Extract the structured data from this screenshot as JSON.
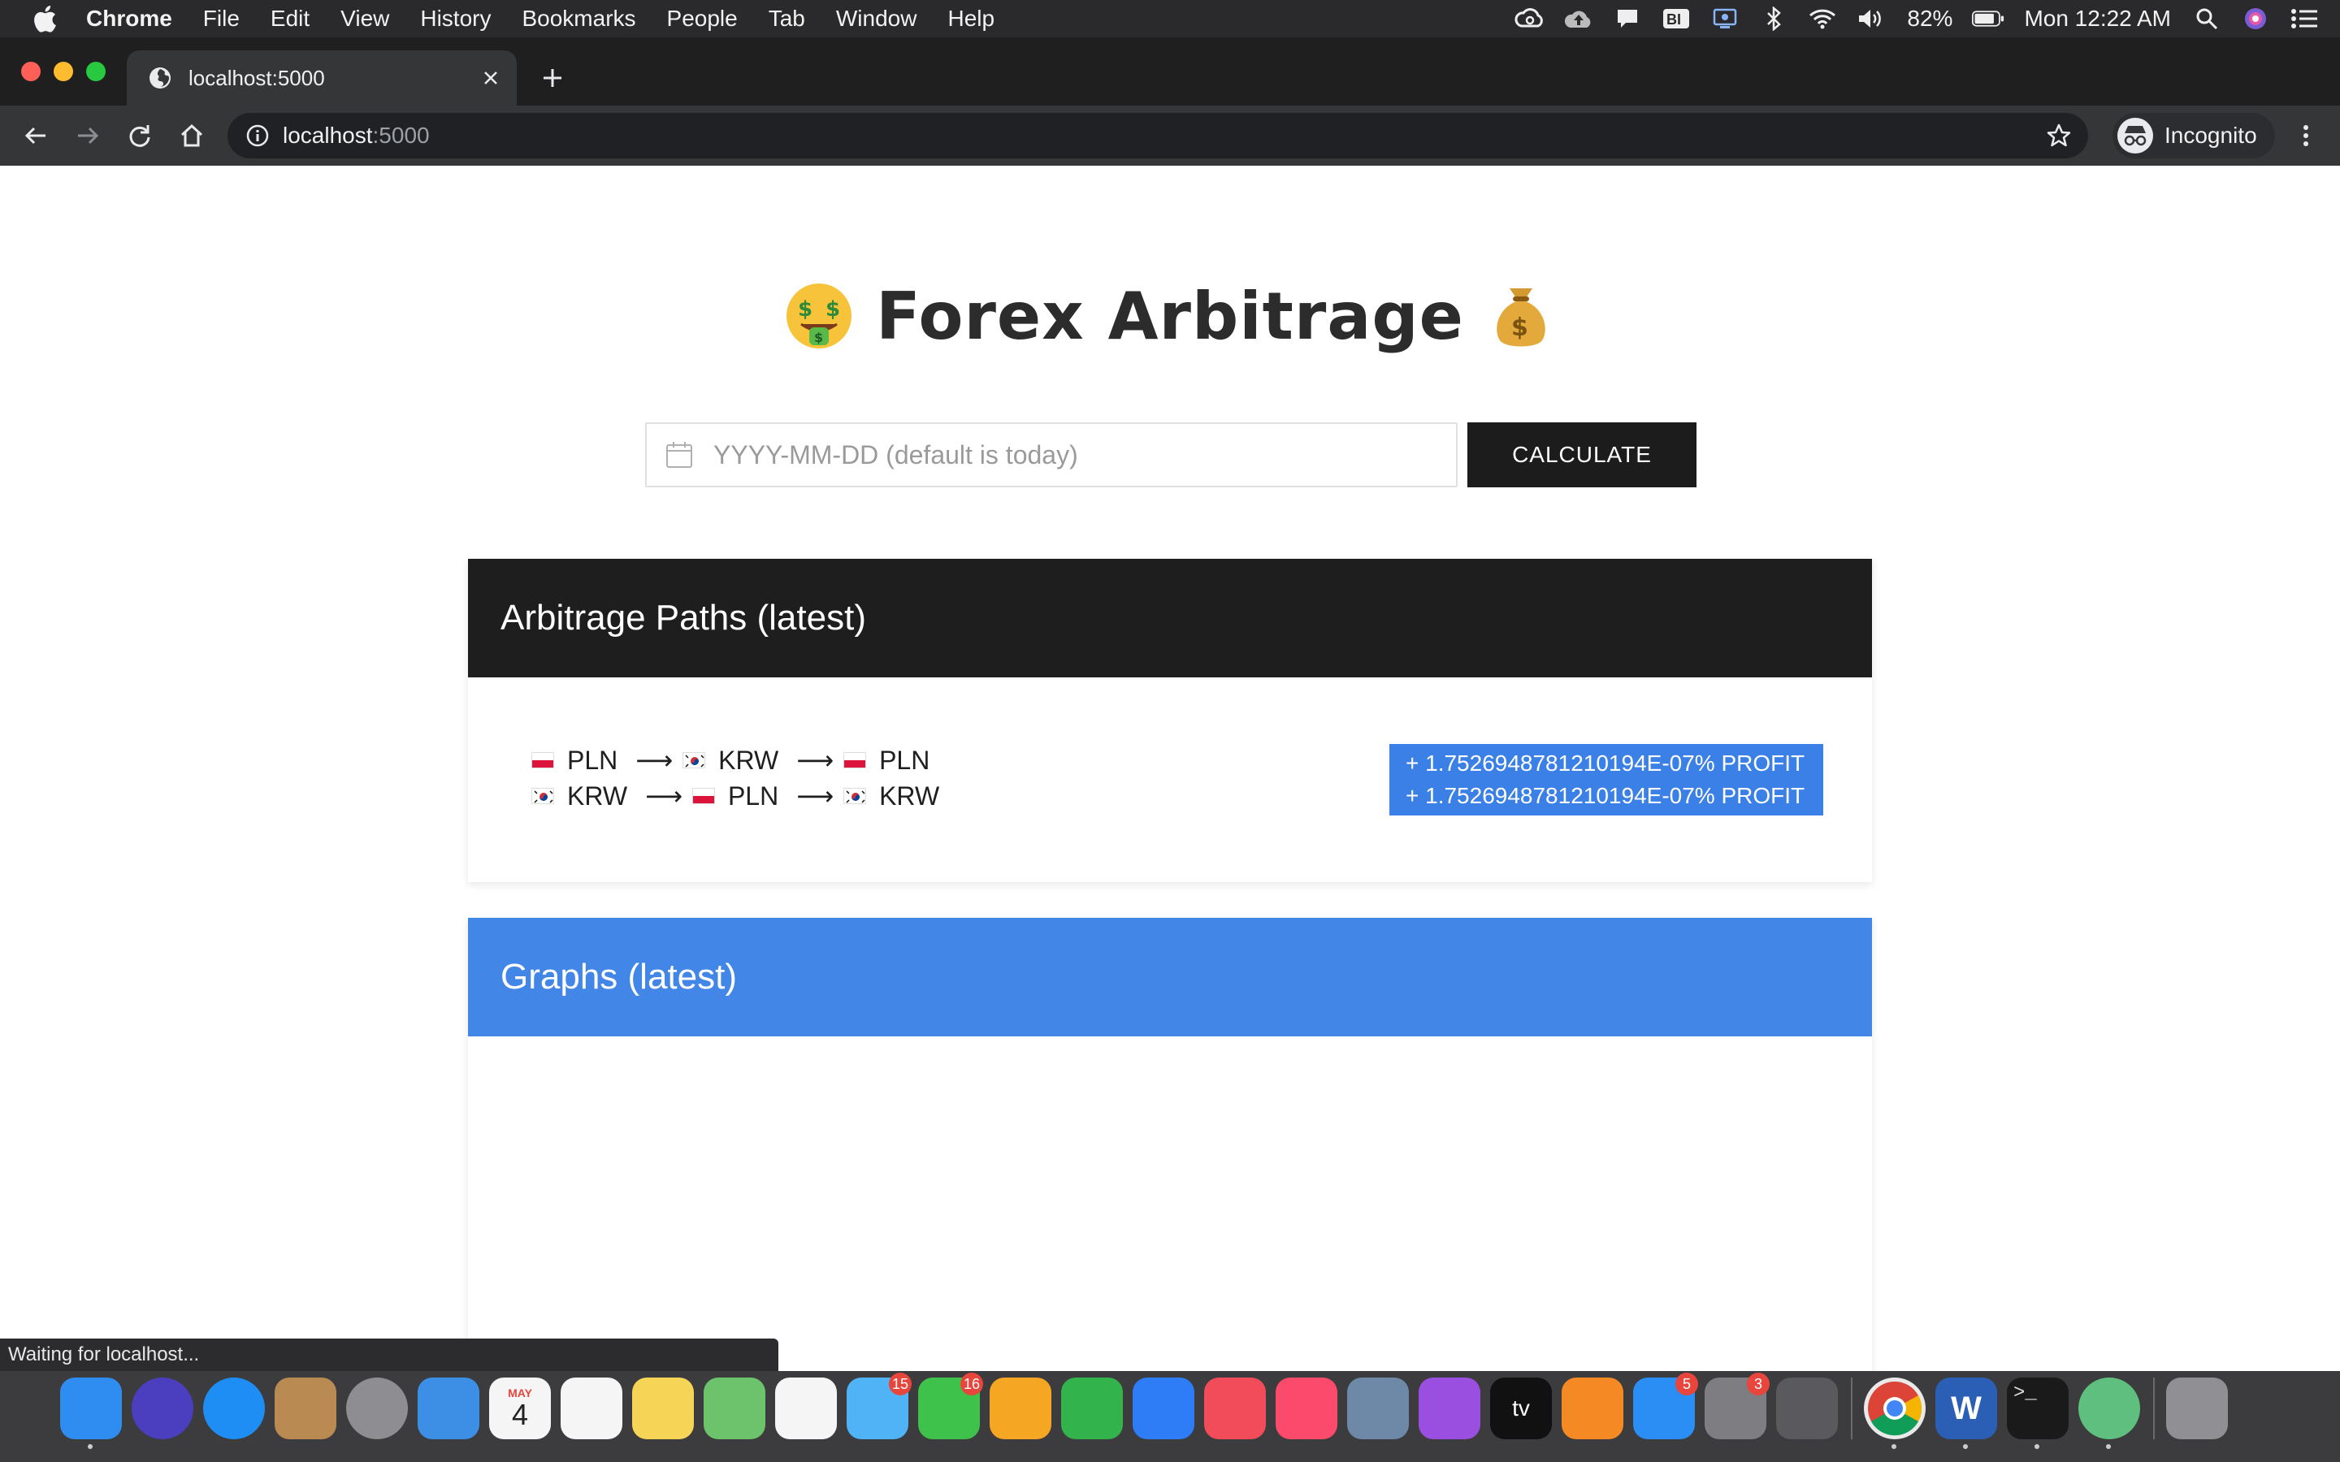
{
  "menubar": {
    "app_name": "Chrome",
    "items": [
      "File",
      "Edit",
      "View",
      "History",
      "Bookmarks",
      "People",
      "Tab",
      "Window",
      "Help"
    ],
    "battery": "82%",
    "clock": "Mon 12:22 AM"
  },
  "browser": {
    "tab_title": "localhost:5000",
    "url_host": "localhost",
    "url_port": ":5000",
    "profile_label": "Incognito"
  },
  "page": {
    "title": "Forex Arbitrage",
    "date_placeholder": "YYYY-MM-DD (default is today)",
    "calculate_label": "CALCULATE",
    "paths_heading": "Arbitrage Paths (latest)",
    "graphs_heading": "Graphs (latest)",
    "paths": [
      [
        "PLN",
        "KRW",
        "PLN"
      ],
      [
        "KRW",
        "PLN",
        "KRW"
      ]
    ],
    "path_flags": [
      [
        "pl",
        "kr",
        "pl"
      ],
      [
        "kr",
        "pl",
        "kr"
      ]
    ],
    "arrow": "⟶",
    "profits": [
      "+ 1.7526948781210194E-07% PROFIT",
      "+ 1.7526948781210194E-07% PROFIT"
    ]
  },
  "status_bar": "Waiting for localhost...",
  "dock": {
    "apps": [
      {
        "name": "finder",
        "color": "#2f8cf0"
      },
      {
        "name": "siri",
        "color": "#4b3fbf"
      },
      {
        "name": "safari",
        "color": "#1e8ef5"
      },
      {
        "name": "contacts",
        "color": "#b98a52"
      },
      {
        "name": "launchpad",
        "color": "#8d8d92"
      },
      {
        "name": "mail",
        "color": "#3d8fe6"
      },
      {
        "name": "calendar",
        "color": "#f5f5f5"
      },
      {
        "name": "reminders",
        "color": "#f5f5f5"
      },
      {
        "name": "notes",
        "color": "#f6d455"
      },
      {
        "name": "maps",
        "color": "#6cc36c"
      },
      {
        "name": "photos",
        "color": "#f5f5f5"
      },
      {
        "name": "messages",
        "color": "#4fb3f6",
        "badge": "15"
      },
      {
        "name": "facetime",
        "color": "#3ec24b",
        "badge": "16"
      },
      {
        "name": "pages",
        "color": "#f5a623"
      },
      {
        "name": "numbers",
        "color": "#33b34c"
      },
      {
        "name": "keynote",
        "color": "#2e7cf6"
      },
      {
        "name": "news",
        "color": "#f24b5a"
      },
      {
        "name": "music",
        "color": "#fb4a6c"
      },
      {
        "name": "preview",
        "color": "#6e88a8"
      },
      {
        "name": "podcasts",
        "color": "#9a4fe0"
      },
      {
        "name": "tv",
        "color": "#111111"
      },
      {
        "name": "books",
        "color": "#f58a25"
      },
      {
        "name": "app-store",
        "color": "#2b8ef5",
        "badge": "5"
      },
      {
        "name": "system-preferences",
        "color": "#7d7d82",
        "badge": "3"
      },
      {
        "name": "screenshot",
        "color": "#5a5a5e"
      },
      {
        "name": "chrome",
        "color": "#e9e9e9"
      },
      {
        "name": "word",
        "color": "#2b5fb5"
      },
      {
        "name": "terminal",
        "color": "#1a1a1a"
      },
      {
        "name": "atom",
        "color": "#5fbf7f"
      },
      {
        "name": "trash",
        "color": "#8f8f94"
      }
    ],
    "weekday_abbrev": "MAY",
    "calendar_day": "4",
    "tv_label": "tv",
    "word_letter": "W",
    "terminal_prompt": ">_"
  },
  "colors": {
    "paths_header": "#1e1e1e",
    "graphs_header": "#4286e8",
    "profit_badge": "#3a80e6",
    "calculate_button": "#1c1c1c"
  }
}
